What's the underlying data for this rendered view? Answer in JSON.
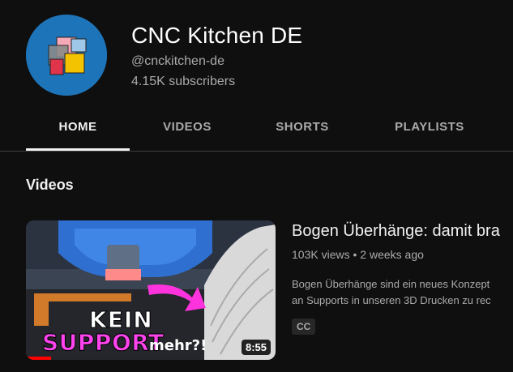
{
  "channel": {
    "name": "CNC Kitchen DE",
    "handle": "@cnckitchen-de",
    "subscribers": "4.15K subscribers",
    "avatar_color": "#1e74b8"
  },
  "tabs": [
    {
      "label": "HOME",
      "active": true
    },
    {
      "label": "VIDEOS",
      "active": false
    },
    {
      "label": "SHORTS",
      "active": false
    },
    {
      "label": "PLAYLISTS",
      "active": false
    }
  ],
  "section": {
    "title": "Videos"
  },
  "video": {
    "title": "Bogen Überhänge: damit bra",
    "views": "103K views",
    "age": "2 weeks ago",
    "separator": "•",
    "description_line1": "Bogen Überhänge sind ein neues Konzept",
    "description_line2": "an Supports in unseren 3D Drucken zu rec",
    "badge": "CC",
    "duration": "8:55",
    "thumbnail_text": {
      "line1": "KEIN",
      "line2": "SUPPORT",
      "line3": "mehr?!"
    },
    "watch_progress": 0.1
  }
}
